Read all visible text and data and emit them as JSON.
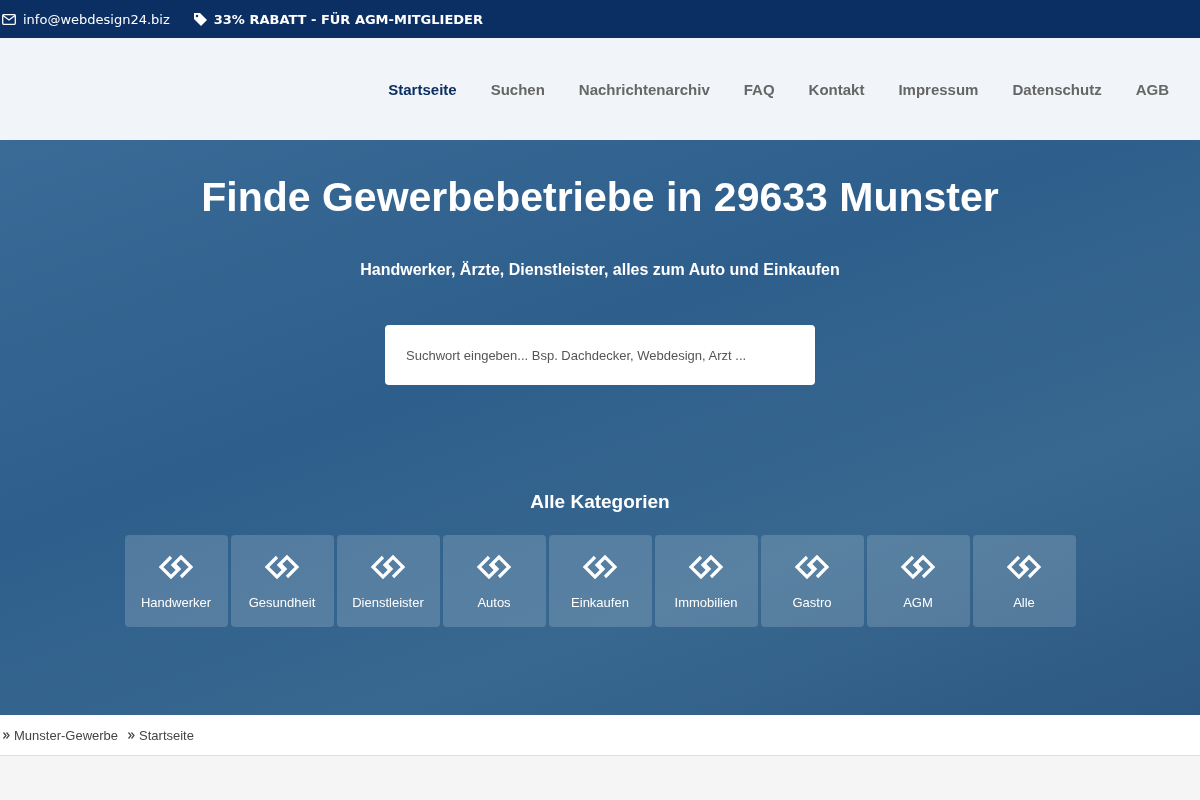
{
  "top_bar": {
    "email": "info@webdesign24.biz",
    "promo": "33% RABATT - FÜR AGM-MITGLIEDER"
  },
  "nav": [
    {
      "label": "Startseite",
      "selected": true
    },
    {
      "label": "Suchen",
      "selected": false
    },
    {
      "label": "Nachrichtenarchiv",
      "selected": false
    },
    {
      "label": "FAQ",
      "selected": false
    },
    {
      "label": "Kontakt",
      "selected": false
    },
    {
      "label": "Impressum",
      "selected": false
    },
    {
      "label": "Datenschutz",
      "selected": false
    },
    {
      "label": "AGB",
      "selected": false
    }
  ],
  "hero": {
    "title": "Finde Gewerbebetriebe in 29633 Munster",
    "subtitle": "Handwerker, Ärzte, Dienstleister, alles zum Auto und Einkaufen",
    "search": {
      "placeholder": "Suchwort eingeben... Bsp. Dachdecker, Webdesign, Arzt ..."
    },
    "categories_title": "Alle Kategorien",
    "categories": [
      "Handwerker",
      "Gesundheit",
      "Dienstleister",
      "Autos",
      "Einkaufen",
      "Immobilien",
      "Gastro",
      "AGM",
      "Alle"
    ]
  },
  "breadcrumb": [
    "Munster-Gewerbe",
    "Startseite"
  ]
}
